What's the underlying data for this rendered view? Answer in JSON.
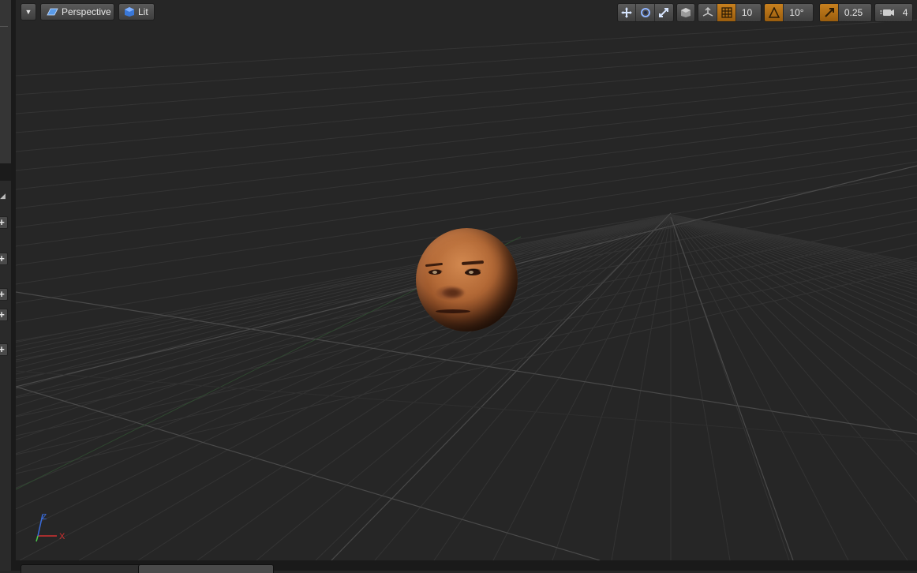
{
  "toolbar": {
    "view_mode": "Perspective",
    "lit_mode": "Lit",
    "grid_snap_value": "10",
    "rotation_snap_value": "10°",
    "scale_snap_value": "0.25",
    "camera_speed_value": "4"
  },
  "colors": {
    "viewport_bg": "#262626",
    "accent_orange": "#c7801e",
    "axis_x": "#d23030",
    "axis_y": "#4cc84c",
    "axis_z": "#3a6cdc"
  },
  "axis_gizmo": {
    "x_label": "X",
    "z_label": "Z"
  },
  "icons": [
    "dropdown-arrow-icon",
    "perspective-icon",
    "lit-cube-icon",
    "translate-icon",
    "rotate-icon",
    "scale-icon",
    "coordinate-space-icon",
    "surface-snap-icon",
    "grid-snap-icon",
    "rotation-snap-icon",
    "scale-snap-icon",
    "camera-speed-icon",
    "add-icon"
  ]
}
